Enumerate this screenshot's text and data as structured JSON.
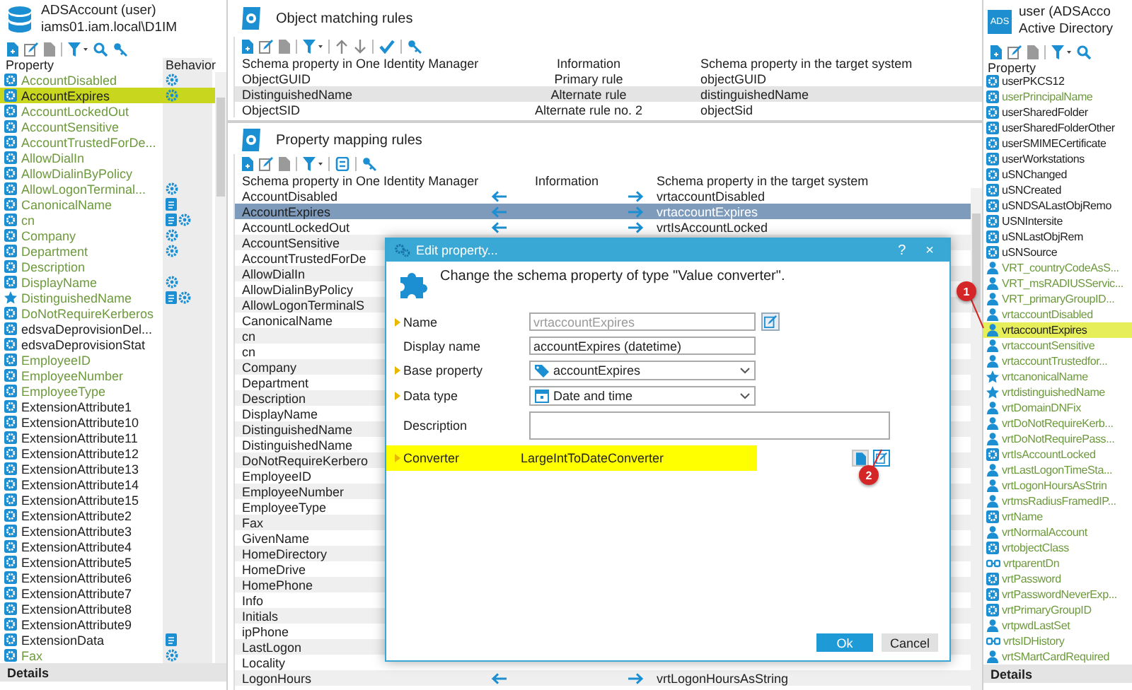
{
  "source_panel": {
    "title": "ADSAccount (user)",
    "subtitle": "iams01.iam.local\\D1IM",
    "columns": [
      "Property",
      "Behavior"
    ],
    "footer": "Details",
    "rows": [
      {
        "name": "AccountDisabled",
        "kind": "property",
        "color": "#6e9a3e",
        "behaviors": [
          {
            "kind": "gear"
          }
        ],
        "selected": false
      },
      {
        "name": "AccountExpires",
        "kind": "property",
        "behaviors": [
          {
            "kind": "gear"
          }
        ],
        "selected": true
      },
      {
        "name": "AccountLockedOut",
        "kind": "property",
        "color": "#6e9a3e",
        "behaviors": [],
        "selected": false
      },
      {
        "name": "AccountSensitive",
        "kind": "property",
        "color": "#6e9a3e",
        "behaviors": [],
        "selected": false
      },
      {
        "name": "AccountTrustedForDe...",
        "kind": "property",
        "color": "#6e9a3e",
        "behaviors": [],
        "selected": false
      },
      {
        "name": "AllowDialIn",
        "kind": "property",
        "color": "#6e9a3e",
        "behaviors": [],
        "selected": false
      },
      {
        "name": "AllowDialinByPolicy",
        "kind": "property",
        "color": "#6e9a3e",
        "behaviors": [],
        "selected": false
      },
      {
        "name": "AllowLogonTerminal...",
        "kind": "property",
        "color": "#6e9a3e",
        "behaviors": [
          {
            "kind": "gear"
          }
        ],
        "selected": false
      },
      {
        "name": "CanonicalName",
        "kind": "property",
        "color": "#6e9a3e",
        "behaviors": [
          {
            "kind": "doc"
          }
        ],
        "selected": false
      },
      {
        "name": "cn",
        "kind": "property",
        "color": "#6e9a3e",
        "behaviors": [
          {
            "kind": "doc"
          },
          {
            "kind": "gear"
          }
        ],
        "selected": false
      },
      {
        "name": "Company",
        "kind": "property",
        "color": "#6e9a3e",
        "behaviors": [
          {
            "kind": "gear"
          }
        ],
        "selected": false
      },
      {
        "name": "Department",
        "kind": "property",
        "color": "#6e9a3e",
        "behaviors": [
          {
            "kind": "gear"
          }
        ],
        "selected": false
      },
      {
        "name": "Description",
        "kind": "property",
        "color": "#6e9a3e",
        "behaviors": [],
        "selected": false
      },
      {
        "name": "DisplayName",
        "kind": "property",
        "color": "#6e9a3e",
        "behaviors": [
          {
            "kind": "gear"
          }
        ],
        "selected": false
      },
      {
        "name": "DistinguishedName",
        "kind": "star",
        "color": "#6e9a3e",
        "behaviors": [
          {
            "kind": "doc"
          },
          {
            "kind": "gear"
          }
        ],
        "selected": false
      },
      {
        "name": "DoNotRequireKerberos",
        "kind": "property",
        "color": "#6e9a3e",
        "behaviors": [],
        "selected": false
      },
      {
        "name": "edsvaDeprovisionDel...",
        "kind": "property",
        "color": "#1e1e1e",
        "behaviors": [],
        "selected": false
      },
      {
        "name": "edsvaDeprovisionStat",
        "kind": "property",
        "color": "#1e1e1e",
        "behaviors": [],
        "selected": false
      },
      {
        "name": "EmployeeID",
        "kind": "property",
        "color": "#6e9a3e",
        "behaviors": [],
        "selected": false
      },
      {
        "name": "EmployeeNumber",
        "kind": "property",
        "color": "#6e9a3e",
        "behaviors": [],
        "selected": false
      },
      {
        "name": "EmployeeType",
        "kind": "property",
        "color": "#6e9a3e",
        "behaviors": [],
        "selected": false
      },
      {
        "name": "ExtensionAttribute1",
        "kind": "property",
        "color": "#1e1e1e",
        "behaviors": [],
        "selected": false
      },
      {
        "name": "ExtensionAttribute10",
        "kind": "property",
        "color": "#1e1e1e",
        "behaviors": [],
        "selected": false
      },
      {
        "name": "ExtensionAttribute11",
        "kind": "property",
        "color": "#1e1e1e",
        "behaviors": [],
        "selected": false
      },
      {
        "name": "ExtensionAttribute12",
        "kind": "property",
        "color": "#1e1e1e",
        "behaviors": [],
        "selected": false
      },
      {
        "name": "ExtensionAttribute13",
        "kind": "property",
        "color": "#1e1e1e",
        "behaviors": [],
        "selected": false
      },
      {
        "name": "ExtensionAttribute14",
        "kind": "property",
        "color": "#1e1e1e",
        "behaviors": [],
        "selected": false
      },
      {
        "name": "ExtensionAttribute15",
        "kind": "property",
        "color": "#1e1e1e",
        "behaviors": [],
        "selected": false
      },
      {
        "name": "ExtensionAttribute2",
        "kind": "property",
        "color": "#1e1e1e",
        "behaviors": [],
        "selected": false
      },
      {
        "name": "ExtensionAttribute3",
        "kind": "property",
        "color": "#1e1e1e",
        "behaviors": [],
        "selected": false
      },
      {
        "name": "ExtensionAttribute4",
        "kind": "property",
        "color": "#1e1e1e",
        "behaviors": [],
        "selected": false
      },
      {
        "name": "ExtensionAttribute5",
        "kind": "property",
        "color": "#1e1e1e",
        "behaviors": [],
        "selected": false
      },
      {
        "name": "ExtensionAttribute6",
        "kind": "property",
        "color": "#1e1e1e",
        "behaviors": [],
        "selected": false
      },
      {
        "name": "ExtensionAttribute7",
        "kind": "property",
        "color": "#1e1e1e",
        "behaviors": [],
        "selected": false
      },
      {
        "name": "ExtensionAttribute8",
        "kind": "property",
        "color": "#1e1e1e",
        "behaviors": [],
        "selected": false
      },
      {
        "name": "ExtensionAttribute9",
        "kind": "property",
        "color": "#1e1e1e",
        "behaviors": [],
        "selected": false
      },
      {
        "name": "ExtensionData",
        "kind": "property",
        "color": "#1e1e1e",
        "behaviors": [
          {
            "kind": "doc"
          }
        ],
        "selected": false
      },
      {
        "name": "Fax",
        "kind": "property",
        "color": "#6e9a3e",
        "behaviors": [
          {
            "kind": "gear"
          }
        ],
        "selected": false
      }
    ]
  },
  "matching_rules": {
    "title": "Object matching rules",
    "columns": [
      "Schema property in One Identity Manager",
      "Information",
      "Schema property in the target system"
    ],
    "rows": [
      {
        "source": "ObjectGUID",
        "information": "Primary rule",
        "target": "objectGUID",
        "selected": false
      },
      {
        "source": "DistinguishedName",
        "information": "Alternate rule",
        "target": "distinguishedName",
        "selected": true
      },
      {
        "source": "ObjectSID",
        "information": "Alternate rule no. 2",
        "target": "objectSid",
        "selected": false
      }
    ]
  },
  "mapping_rules": {
    "title": "Property mapping rules",
    "columns": [
      "Schema property in One Identity Manager",
      "Information",
      "Schema property in the target system"
    ],
    "rows": [
      {
        "source": "AccountDisabled",
        "target": "vrtaccountDisabled",
        "selected": false
      },
      {
        "source": "AccountExpires",
        "target": "vrtaccountExpires",
        "selected": true
      },
      {
        "source": "AccountLockedOut",
        "target": "vrtIsAccountLocked",
        "selected": false
      },
      {
        "source": "AccountSensitive",
        "selected": false
      },
      {
        "source": "AccountTrustedForDe",
        "selected": false
      },
      {
        "source": "AllowDialIn",
        "selected": false
      },
      {
        "source": "AllowDialinByPolicy",
        "selected": false
      },
      {
        "source": "AllowLogonTerminalS",
        "selected": false
      },
      {
        "source": "CanonicalName",
        "selected": false
      },
      {
        "source": "cn",
        "selected": false
      },
      {
        "source": "cn",
        "selected": false
      },
      {
        "source": "Company",
        "selected": false
      },
      {
        "source": "Department",
        "selected": false
      },
      {
        "source": "Description",
        "selected": false
      },
      {
        "source": "DisplayName",
        "selected": false
      },
      {
        "source": "DistinguishedName",
        "selected": false
      },
      {
        "source": "DistinguishedName",
        "selected": false
      },
      {
        "source": "DoNotRequireKerbero",
        "selected": false
      },
      {
        "source": "EmployeeID",
        "selected": false
      },
      {
        "source": "EmployeeNumber",
        "selected": false
      },
      {
        "source": "EmployeeType",
        "selected": false
      },
      {
        "source": "Fax",
        "selected": false
      },
      {
        "source": "GivenName",
        "selected": false
      },
      {
        "source": "HomeDirectory",
        "selected": false
      },
      {
        "source": "HomeDrive",
        "selected": false
      },
      {
        "source": "HomePhone",
        "selected": false
      },
      {
        "source": "Info",
        "selected": false
      },
      {
        "source": "Initials",
        "selected": false
      },
      {
        "source": "ipPhone",
        "selected": false
      },
      {
        "source": "LastLogon",
        "selected": false
      },
      {
        "source": "Locality",
        "selected": false
      },
      {
        "source": "LogonHours",
        "target": "vrtLogonHoursAsString",
        "selected": false
      }
    ]
  },
  "dialog": {
    "title": "Edit property...",
    "help": "?",
    "close": "×",
    "heading": "Change the schema property of type \"Value converter\".",
    "fields": [
      {
        "label": "Name",
        "kind": "text",
        "value": "vrtaccountExpires",
        "disabled": true,
        "required": true
      },
      {
        "label": "Display name",
        "kind": "text",
        "value": "accountExpires (datetime)",
        "disabled": false,
        "required": false
      },
      {
        "label": "Base property",
        "kind": "reference",
        "value": "accountExpires",
        "required": true
      },
      {
        "label": "Data type",
        "kind": "datatype",
        "value": "Date and time",
        "required": true
      },
      {
        "label": "Description",
        "kind": "textarea",
        "required": false
      },
      {
        "label": "Converter",
        "kind": "static",
        "value": "LargeIntToDateConverter",
        "required": true,
        "highlighted": true
      }
    ],
    "buttons": [
      {
        "label": "Ok",
        "kind": "primary"
      },
      {
        "label": "Cancel",
        "kind": "secondary"
      }
    ]
  },
  "target_panel": {
    "badge": "ADS",
    "title": "user (ADSAcco",
    "subtitle": "Active Directory",
    "columns": [
      "Property"
    ],
    "footer": "Details",
    "rows": [
      {
        "name": "userPKCS12",
        "kind": "property",
        "color": "#1e1e1e",
        "selected": false
      },
      {
        "name": "userPrincipalName",
        "kind": "property",
        "color": "#6e9a3e",
        "selected": false
      },
      {
        "name": "userSharedFolder",
        "kind": "property",
        "color": "#1e1e1e",
        "selected": false
      },
      {
        "name": "userSharedFolderOther",
        "kind": "property",
        "color": "#1e1e1e",
        "selected": false
      },
      {
        "name": "userSMIMECertificate",
        "kind": "property",
        "color": "#1e1e1e",
        "selected": false
      },
      {
        "name": "userWorkstations",
        "kind": "property",
        "color": "#1e1e1e",
        "selected": false
      },
      {
        "name": "uSNChanged",
        "kind": "property",
        "color": "#1e1e1e",
        "selected": false
      },
      {
        "name": "uSNCreated",
        "kind": "property",
        "color": "#1e1e1e",
        "selected": false
      },
      {
        "name": "uSNDSALastObjRemo",
        "kind": "property",
        "color": "#1e1e1e",
        "selected": false
      },
      {
        "name": "USNIntersite",
        "kind": "property",
        "color": "#1e1e1e",
        "selected": false
      },
      {
        "name": "uSNLastObjRem",
        "kind": "property",
        "color": "#1e1e1e",
        "selected": false
      },
      {
        "name": "uSNSource",
        "kind": "property",
        "color": "#1e1e1e",
        "selected": false
      },
      {
        "name": "VRT_countryCodeAsS...",
        "kind": "person",
        "color": "#6e9a3e",
        "selected": false
      },
      {
        "name": "VRT_msRADIUSServic...",
        "kind": "person",
        "color": "#6e9a3e",
        "selected": false
      },
      {
        "name": "VRT_primaryGroupID...",
        "kind": "person",
        "color": "#6e9a3e",
        "selected": false
      },
      {
        "name": "vrtaccountDisabled",
        "kind": "person",
        "color": "#6e9a3e",
        "selected": false
      },
      {
        "name": "vrtaccountExpires",
        "kind": "person",
        "selected": true
      },
      {
        "name": "vrtaccountSensitive",
        "kind": "person",
        "color": "#6e9a3e",
        "selected": false
      },
      {
        "name": "vrtaccountTrustedfor...",
        "kind": "person",
        "color": "#6e9a3e",
        "selected": false
      },
      {
        "name": "vrtcanonicalName",
        "kind": "star",
        "color": "#6e9a3e",
        "selected": false
      },
      {
        "name": "vrtdistinguishedName",
        "kind": "star",
        "color": "#6e9a3e",
        "selected": false
      },
      {
        "name": "vrtDomainDNFix",
        "kind": "person",
        "color": "#6e9a3e",
        "selected": false
      },
      {
        "name": "vrtDoNotRequireKerb...",
        "kind": "person",
        "color": "#6e9a3e",
        "selected": false
      },
      {
        "name": "vrtDoNotRequirePass...",
        "kind": "person",
        "color": "#6e9a3e",
        "selected": false
      },
      {
        "name": "vrtIsAccountLocked",
        "kind": "property",
        "color": "#6e9a3e",
        "selected": false
      },
      {
        "name": "vrtLastLogonTimeSta...",
        "kind": "person",
        "color": "#6e9a3e",
        "selected": false
      },
      {
        "name": "vrtLogonHoursAsStrin",
        "kind": "person",
        "color": "#6e9a3e",
        "selected": false
      },
      {
        "name": "vrtmsRadiusFramedIP...",
        "kind": "person",
        "color": "#6e9a3e",
        "selected": false
      },
      {
        "name": "vrtName",
        "kind": "property",
        "color": "#6e9a3e",
        "selected": false
      },
      {
        "name": "vrtNormalAccount",
        "kind": "person",
        "color": "#6e9a3e",
        "selected": false
      },
      {
        "name": "vrtobjectClass",
        "kind": "property",
        "color": "#6e9a3e",
        "selected": false
      },
      {
        "name": "vrtparentDn",
        "kind": "link",
        "color": "#6e9a3e",
        "selected": false
      },
      {
        "name": "vrtPassword",
        "kind": "property",
        "color": "#6e9a3e",
        "selected": false
      },
      {
        "name": "vrtPasswordNeverExp...",
        "kind": "property",
        "color": "#6e9a3e",
        "selected": false
      },
      {
        "name": "vrtPrimaryGroupID",
        "kind": "property",
        "color": "#6e9a3e",
        "selected": false
      },
      {
        "name": "vrtpwdLastSet",
        "kind": "person",
        "color": "#6e9a3e",
        "selected": false
      },
      {
        "name": "vrtsIDHistory",
        "kind": "link",
        "color": "#6e9a3e",
        "selected": false
      },
      {
        "name": "vrtSMartCardRequired",
        "kind": "person",
        "color": "#6e9a3e",
        "selected": false
      }
    ]
  },
  "callouts": [
    {
      "label": "1"
    },
    {
      "label": "2"
    }
  ]
}
